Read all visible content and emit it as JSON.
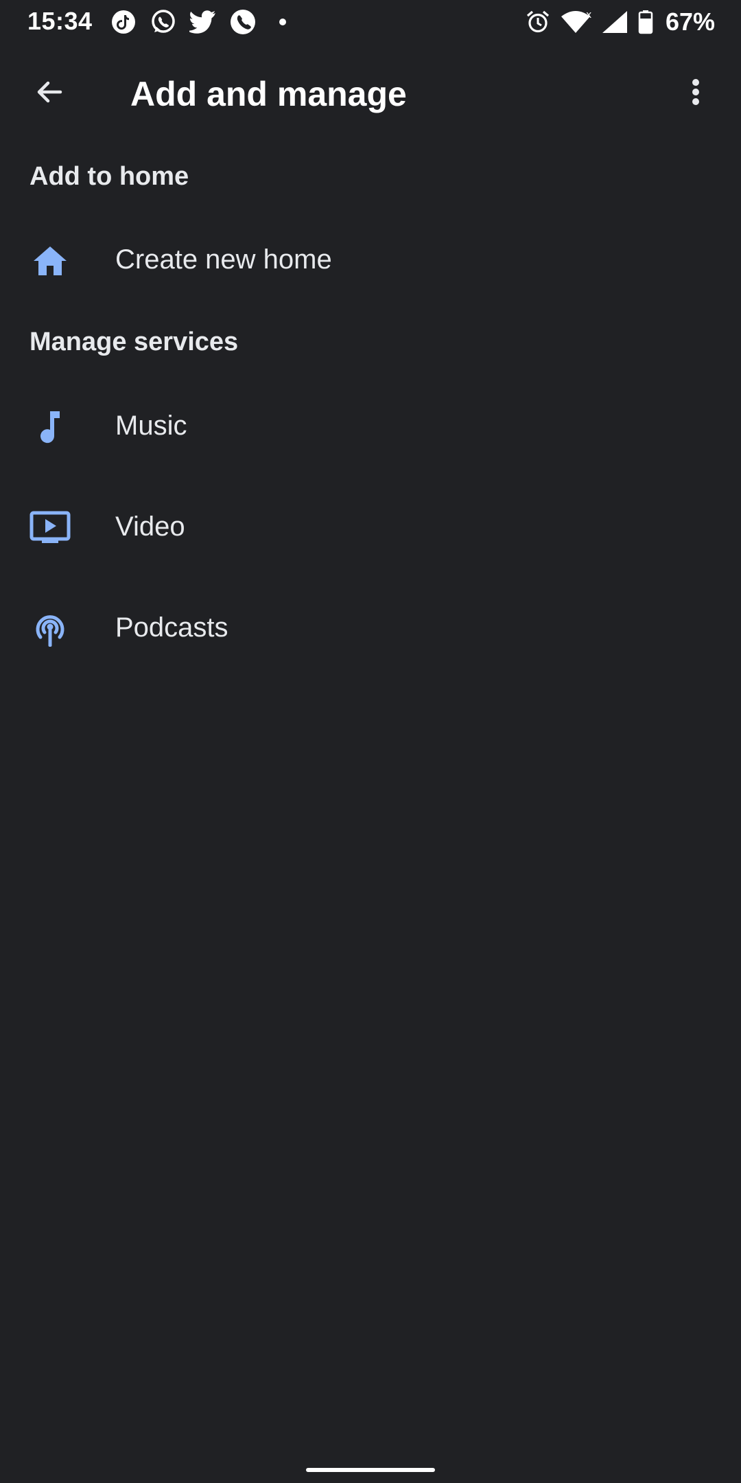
{
  "status_bar": {
    "time": "15:34",
    "left_icons": [
      "tiktok-icon",
      "whatsapp-icon",
      "twitter-icon",
      "phone-call-icon",
      "notification-dot-icon"
    ],
    "right_icons": [
      "alarm-icon",
      "wifi-icon",
      "mobile-signal-icon",
      "battery-icon"
    ],
    "battery_percent": "67%"
  },
  "app_bar": {
    "title": "Add and manage",
    "back_icon": "arrow-back-icon",
    "menu_icon": "more-vert-icon"
  },
  "sections": {
    "add_to_home": {
      "header": "Add to home",
      "items": [
        {
          "label": "Create new home",
          "icon": "home-icon"
        }
      ]
    },
    "manage_services": {
      "header": "Manage services",
      "items": [
        {
          "label": "Music",
          "icon": "music-note-icon"
        },
        {
          "label": "Video",
          "icon": "video-icon"
        },
        {
          "label": "Podcasts",
          "icon": "podcast-icon"
        }
      ]
    }
  },
  "colors": {
    "background": "#202124",
    "accent": "#8ab4f8",
    "text_primary": "#e8eaed",
    "text_strong": "#ffffff"
  }
}
